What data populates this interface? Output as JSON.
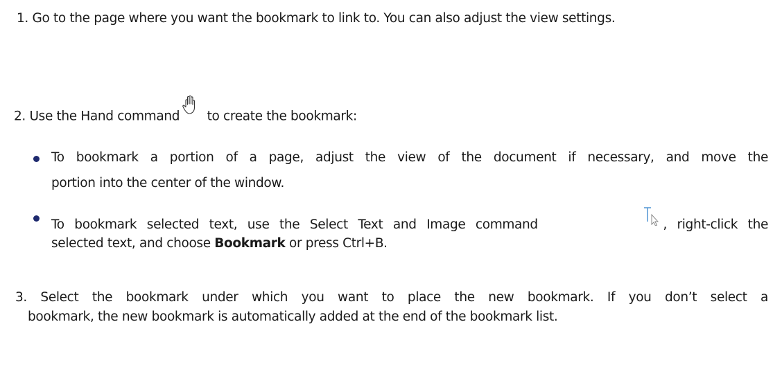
{
  "steps": {
    "step1": "1. Go to the page where you want the bookmark to link to. You can also adjust the view settings.",
    "step2_before": "2. Use the Hand command",
    "step2_after": " to create the bookmark:",
    "hand_icon": "hand-icon",
    "bullet1_line1": "To bookmark a portion of a page, adjust the view of the document if necessary, and move the",
    "bullet1_line2": "portion into the center of the window.",
    "bullet2_line1_before": "To bookmark selected text, use the Select Text and Image command",
    "bullet2_line1_after": ", right-click the",
    "select_text_icon": "select-text-image-icon",
    "bullet2_line2_before": "selected text, and choose ",
    "bullet2_line2_bold": "Bookmark",
    "bullet2_line2_after": " or press Ctrl+B.",
    "step3_line1": "3. Select the bookmark under which you want to place the new bookmark. If you don’t select a",
    "step3_line2": "bookmark, the new bookmark is automatically added at the end of the bookmark list."
  },
  "colors": {
    "text": "#1a1a1a",
    "bullet": "#1e2a6e",
    "select_icon": "#5b9bd5"
  }
}
